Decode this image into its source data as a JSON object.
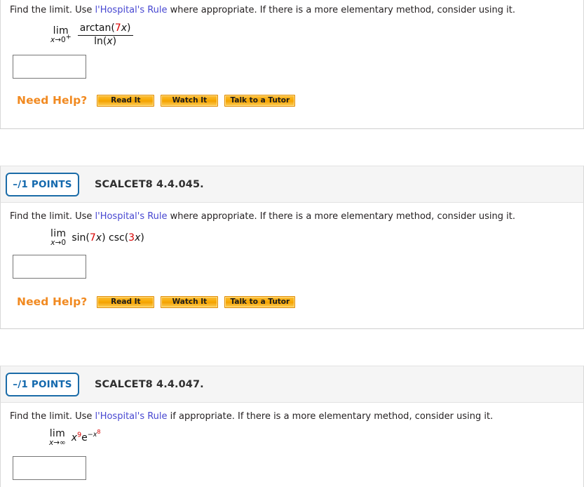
{
  "page": {
    "accent_orange": "#f18a21",
    "link_blue": "#4747d1",
    "badge_blue": "#1268ad",
    "red_value": "#d80000"
  },
  "help": {
    "label": "Need Help?",
    "buttons": [
      {
        "label": "Read It"
      },
      {
        "label": "Watch It"
      },
      {
        "label": "Talk to a Tutor"
      }
    ]
  },
  "answer_placeholder": "",
  "questions": [
    {
      "id": "q1",
      "prompt": {
        "before": "Find the limit. Use ",
        "link": "l'Hospital's Rule",
        "after": " where appropriate. If there is a more elementary method, consider using it."
      },
      "math": {
        "lim_word": "lim",
        "lim_sub_var": "x",
        "lim_sub_arrow": "→",
        "lim_sub_target": "0",
        "lim_sub_sup": "+",
        "type": "fraction",
        "numerator": {
          "fn": "arctan(",
          "coef": "7",
          "var": "x",
          "close": ")"
        },
        "denominator": {
          "fn": "ln(",
          "var": "x",
          "close": ")"
        }
      },
      "answer_value": ""
    },
    {
      "id": "q2",
      "header": {
        "points": "–/1 POINTS",
        "title": "SCALCET8 4.4.045."
      },
      "prompt": {
        "before": "Find the limit. Use ",
        "link": "l'Hospital's Rule",
        "after": " where appropriate. If there is a more elementary method, consider using it."
      },
      "math": {
        "lim_word": "lim",
        "lim_sub_var": "x",
        "lim_sub_arrow": "→",
        "lim_sub_target": "0",
        "lim_sub_sup": "",
        "type": "inline",
        "expr": {
          "fn1": "sin(",
          "coef1": "7",
          "var1": "x",
          "close1": ") ",
          "fn2": "csc(",
          "coef2": "3",
          "var2": "x",
          "close2": ")"
        }
      },
      "answer_value": ""
    },
    {
      "id": "q3",
      "header": {
        "points": "–/1 POINTS",
        "title": "SCALCET8 4.4.047."
      },
      "prompt": {
        "before": "Find the limit. Use ",
        "link": "l'Hospital's Rule",
        "after": " if appropriate. If there is a more elementary method, consider using it."
      },
      "math": {
        "lim_word": "lim",
        "lim_sub_var": "x",
        "lim_sub_arrow": "→",
        "lim_sub_target": "∞",
        "lim_sub_sup": "",
        "type": "power",
        "expr": {
          "base1": "x",
          "exp1": "9",
          "base2": "e",
          "expsign": "−",
          "expbase": "x",
          "expexp": "8"
        }
      },
      "answer_value": ""
    }
  ]
}
